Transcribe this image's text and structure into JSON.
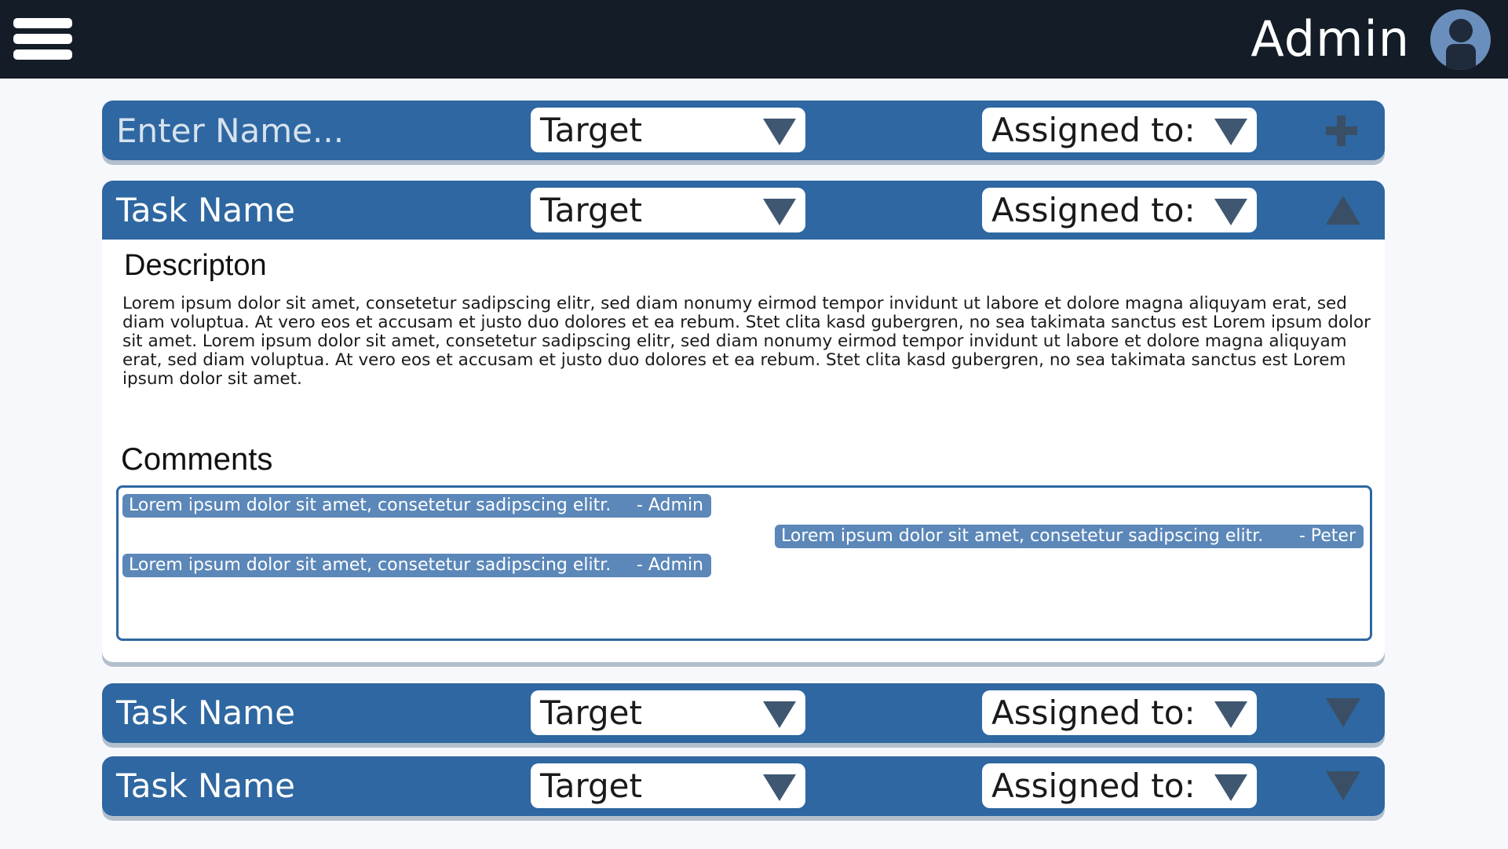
{
  "header": {
    "menu_icon": "hamburger-menu-icon",
    "user_name": "Admin",
    "avatar_icon": "user-avatar-icon"
  },
  "new_task": {
    "name_placeholder": "Enter Name...",
    "target_label": "Target",
    "assigned_label": "Assigned to:",
    "add_icon": "plus-icon"
  },
  "tasks": [
    {
      "name": "Task Name",
      "target_label": "Target",
      "assigned_label": "Assigned to:",
      "expanded": true,
      "description_heading": "Descripton",
      "description": "Lorem ipsum dolor sit amet, consetetur sadipscing elitr, sed diam nonumy eirmod tempor invidunt ut labore et dolore magna aliquyam erat, sed diam voluptua. At vero eos et accusam et justo duo dolores et ea rebum. Stet clita kasd gubergren, no sea takimata sanctus est Lorem ipsum dolor sit amet. Lorem ipsum dolor sit amet, consetetur sadipscing elitr, sed diam nonumy eirmod tempor invidunt ut labore et dolore magna aliquyam erat, sed diam voluptua. At vero eos et accusam et justo duo dolores et ea rebum. Stet clita kasd gubergren, no sea takimata sanctus est Lorem ipsum dolor sit amet.",
      "comments_heading": "Comments",
      "comments": [
        {
          "text": "Lorem ipsum dolor sit amet, consetetur sadipscing elitr.",
          "author": "- Admin",
          "side": "left"
        },
        {
          "text": "Lorem ipsum dolor sit amet, consetetur sadipscing elitr.",
          "author": "- Peter",
          "side": "right"
        },
        {
          "text": "Lorem ipsum dolor sit amet, consetetur sadipscing elitr.",
          "author": "- Admin",
          "side": "left"
        }
      ]
    },
    {
      "name": "Task Name",
      "target_label": "Target",
      "assigned_label": "Assigned to:",
      "expanded": false
    },
    {
      "name": "Task Name",
      "target_label": "Target",
      "assigned_label": "Assigned to:",
      "expanded": false
    }
  ],
  "colors": {
    "header_bg": "#141c27",
    "task_bar": "#2e67a1",
    "comment_bubble": "#5b87b9",
    "icon": "#3a4f66"
  }
}
